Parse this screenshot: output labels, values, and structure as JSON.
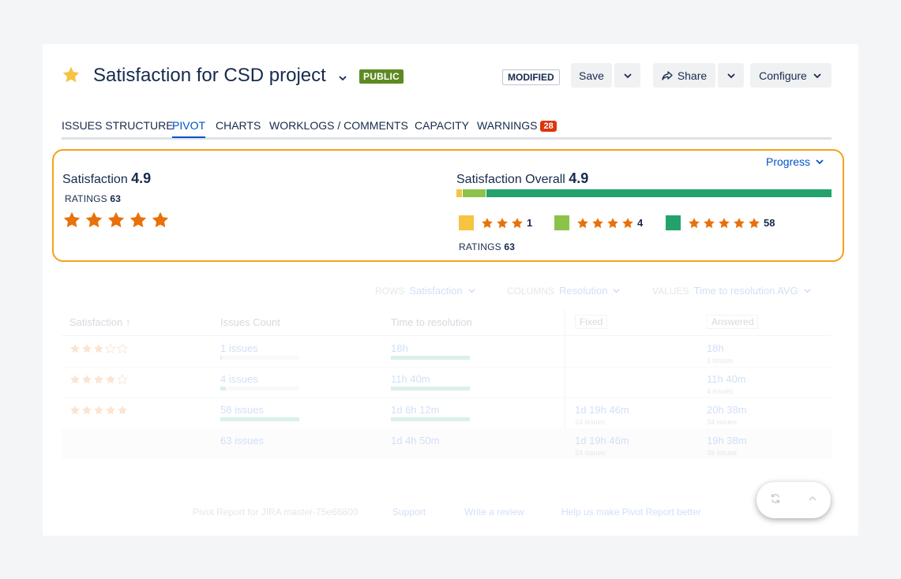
{
  "colors": {
    "accent": "#0052cc",
    "star_orange": "#e8710a",
    "title_star": "#f6c342",
    "panel_border": "#f4a11a",
    "public_badge": "#5e8a23",
    "warning_badge": "#de350b",
    "bar_yellow": "#f6c342",
    "bar_lightgreen": "#8bc34a",
    "bar_green": "#23a26d"
  },
  "header": {
    "title": "Satisfaction for CSD project",
    "public_label": "PUBLIC",
    "modified_label": "MODIFIED",
    "save_label": "Save",
    "share_label": "Share",
    "configure_label": "Configure"
  },
  "tabs": [
    {
      "label": "ISSUES STRUCTURE"
    },
    {
      "label": "PIVOT"
    },
    {
      "label": "CHARTS"
    },
    {
      "label": "WORKLOGS / COMMENTS"
    },
    {
      "label": "CAPACITY"
    },
    {
      "label": "WARNINGS",
      "count": "28"
    }
  ],
  "satisfaction": {
    "label": "Satisfaction",
    "score": "4.9",
    "ratings_label": "RATINGS",
    "ratings_count": "63",
    "stars": 5,
    "progress_label": "Progress",
    "overall_label": "Satisfaction Overall",
    "overall_score": "4.9",
    "distribution": [
      {
        "stars": 3,
        "count": "1",
        "fraction": 0.0159
      },
      {
        "stars": 4,
        "count": "4",
        "fraction": 0.0635
      },
      {
        "stars": 5,
        "count": "58",
        "fraction": 0.9206
      }
    ]
  },
  "pivot": {
    "rows_key": "ROWS",
    "rows_value": "Satisfaction",
    "columns_key": "COLUMNS",
    "columns_value": "Resolution",
    "values_key": "VALUES",
    "values_value": "Time to resolution AVG",
    "headers": {
      "satisfaction": "Satisfaction",
      "issues_count": "Issues Count",
      "time_to_resolution": "Time to resolution",
      "fixed": "Fixed",
      "answered": "Answered"
    },
    "rows": [
      {
        "stars": 3,
        "issues": "1 issues",
        "issues_fill": 0.02,
        "time": "18h",
        "time_fill": 1,
        "fixed": "",
        "fixed_sub": "",
        "answered": "18h",
        "answered_sub": "1 issues"
      },
      {
        "stars": 4,
        "issues": "4 issues",
        "issues_fill": 0.07,
        "time": "11h 40m",
        "time_fill": 1,
        "fixed": "",
        "fixed_sub": "",
        "answered": "11h 40m",
        "answered_sub": "4 issues"
      },
      {
        "stars": 5,
        "issues": "58 issues",
        "issues_fill": 1,
        "time": "1d 6h 12m",
        "time_fill": 1,
        "fixed": "1d 19h 46m",
        "fixed_sub": "24 issues",
        "answered": "20h 38m",
        "answered_sub": "34 issues"
      }
    ],
    "total": {
      "issues": "63 issues",
      "time": "1d 4h 50m",
      "fixed": "1d 19h 46m",
      "fixed_sub": "24 issues",
      "answered": "19h 38m",
      "answered_sub": "39 issues"
    }
  },
  "footer": {
    "version": "Pivot Report for JIRA master-75e66800",
    "support": "Support",
    "review": "Write a review",
    "help": "Help us make Pivot Report better"
  }
}
